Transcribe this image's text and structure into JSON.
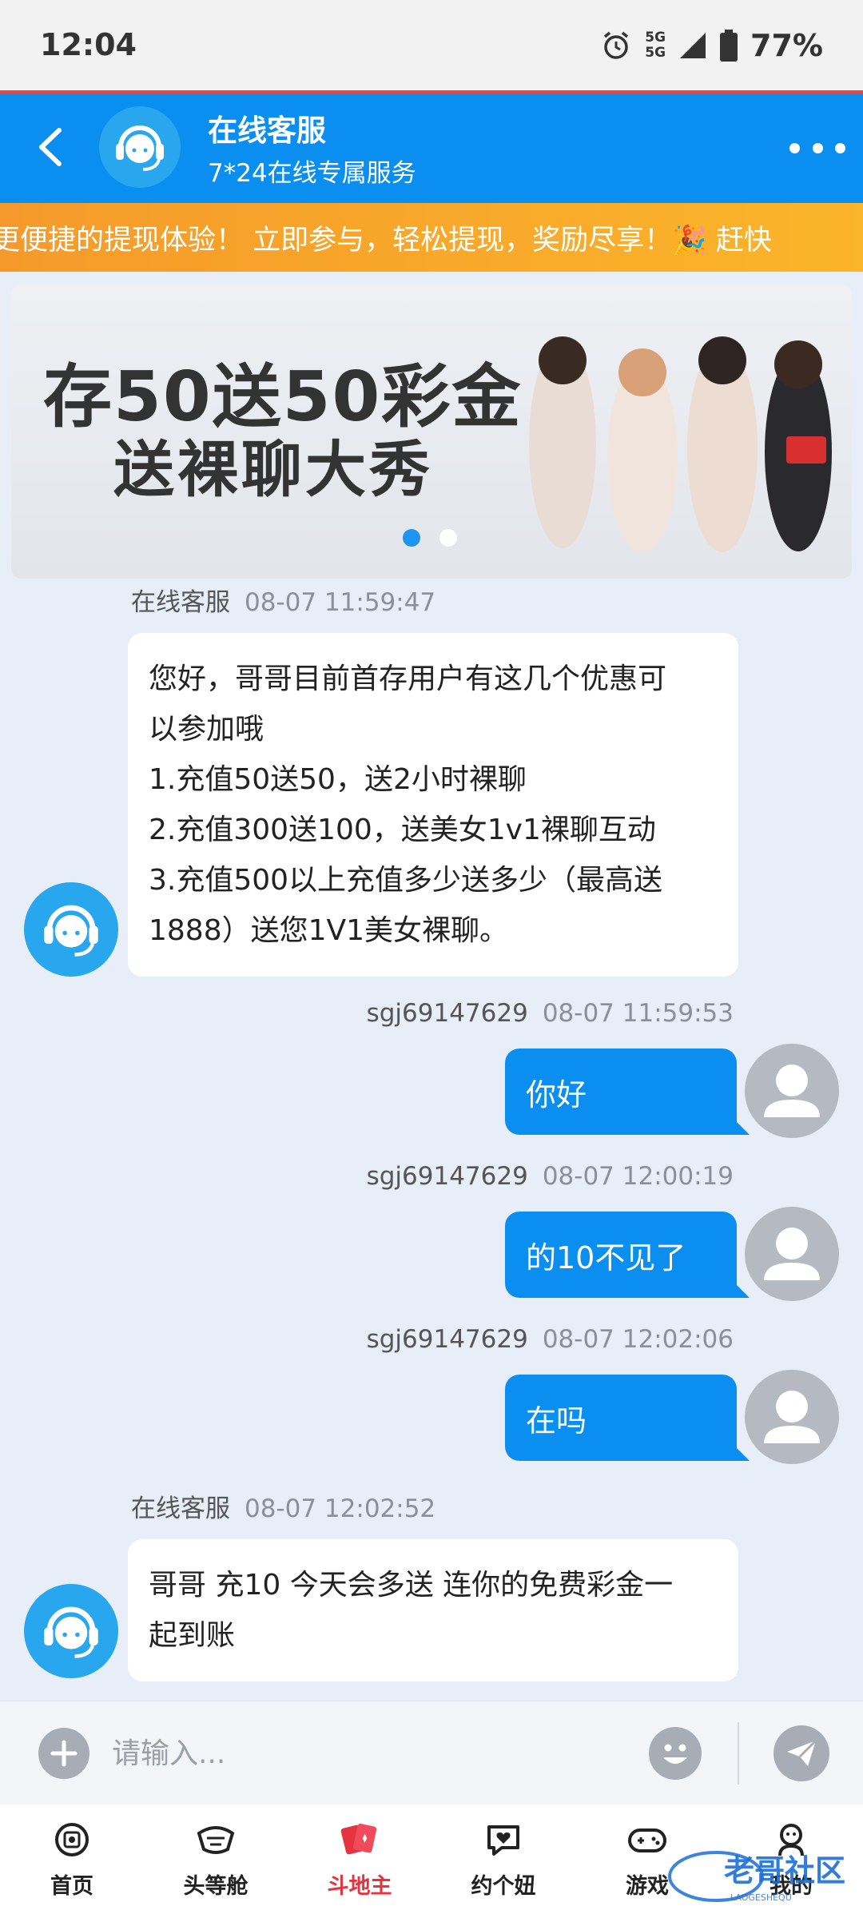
{
  "status_bar": {
    "time": "12:04",
    "net_top": "5G",
    "net_bottom": "5G",
    "battery": "77%"
  },
  "header": {
    "title": "在线客服",
    "subtitle": "7*24在线专属服务"
  },
  "marquee": {
    "text": "更便捷的提现体验！ 立即参与，轻松提现，奖励尽享！🎉 赶快"
  },
  "banner": {
    "line1": "存50送50彩金",
    "line2": "送裸聊大秀"
  },
  "messages": [
    {
      "sender": "在线客服",
      "time": "08-07 11:59:47",
      "lines": [
        "您好，哥哥目前首存用户有这几个优惠可",
        "以参加哦",
        "1.充值50送50，送2小时裸聊",
        "2.充值300送100，送美女1v1裸聊互动",
        "3.充值500以上充值多少送多少（最高送",
        "1888）送您1V1美女裸聊。"
      ]
    },
    {
      "sender": "sgj69147629",
      "time": "08-07 11:59:53",
      "text": "你好"
    },
    {
      "sender": "sgj69147629",
      "time": "08-07 12:00:19",
      "text": "的10不见了"
    },
    {
      "sender": "sgj69147629",
      "time": "08-07 12:02:06",
      "text": "在吗"
    },
    {
      "sender": "在线客服",
      "time": "08-07 12:02:52",
      "lines": [
        "哥哥 充10 今天会多送 连你的免费彩金一",
        "起到账"
      ]
    }
  ],
  "input": {
    "placeholder": "请输入..."
  },
  "nav": [
    {
      "label": "首页",
      "icon": "home-icon"
    },
    {
      "label": "头等舱",
      "icon": "cabin-icon"
    },
    {
      "label": "斗地主",
      "icon": "cards-icon",
      "active": true
    },
    {
      "label": "约个妞",
      "icon": "chat-heart-icon"
    },
    {
      "label": "游戏",
      "icon": "gamepad-icon"
    },
    {
      "label": "我的",
      "icon": "profile-icon"
    }
  ],
  "watermark": {
    "text": "老哥社区",
    "sub": "LAOGESHEQU"
  },
  "colors": {
    "primary": "#0a8ff0",
    "marquee": "#f59a2a",
    "active_nav": "#e53340",
    "bg": "#e8eef8"
  }
}
